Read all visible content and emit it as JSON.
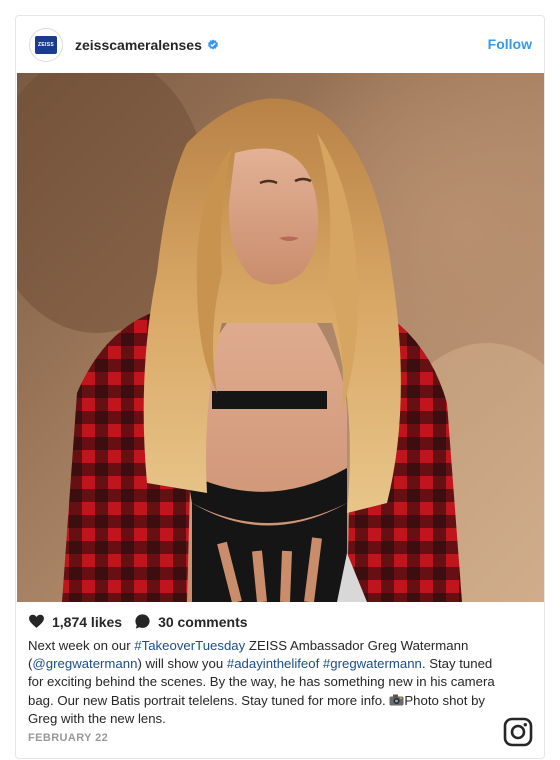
{
  "header": {
    "brand_logo_text": "ZEISS",
    "username": "zeisscameralenses",
    "follow_label": "Follow"
  },
  "stats": {
    "likes": "1,874 likes",
    "comments": "30 comments"
  },
  "caption": {
    "part1": "Next week on our ",
    "tag_takeover": "#TakeoverTuesday",
    "part2": " ZEISS Ambassador Greg Watermann (",
    "mention": "@gregwatermann",
    "part3": ") will show you ",
    "tag_dayinthelife": "#adayinthelifeof",
    "part4": " ",
    "tag_gregwatermann": "#gregwatermann",
    "part5": ". Stay tuned for exciting behind the scenes. By the way, he has something new in his camera bag. Our new Batis portrait telelens. Stay tuned for more info. ",
    "part6": "Photo shot by Greg with the new lens."
  },
  "date": "FEBRUARY 22",
  "colors": {
    "accent": "#3897f0",
    "link": "#1d4e89",
    "brand": "#1a3c8f"
  },
  "icons": [
    "verified-badge-icon",
    "heart-icon",
    "comment-bubble-icon",
    "camera-emoji-icon",
    "instagram-logo-icon"
  ]
}
